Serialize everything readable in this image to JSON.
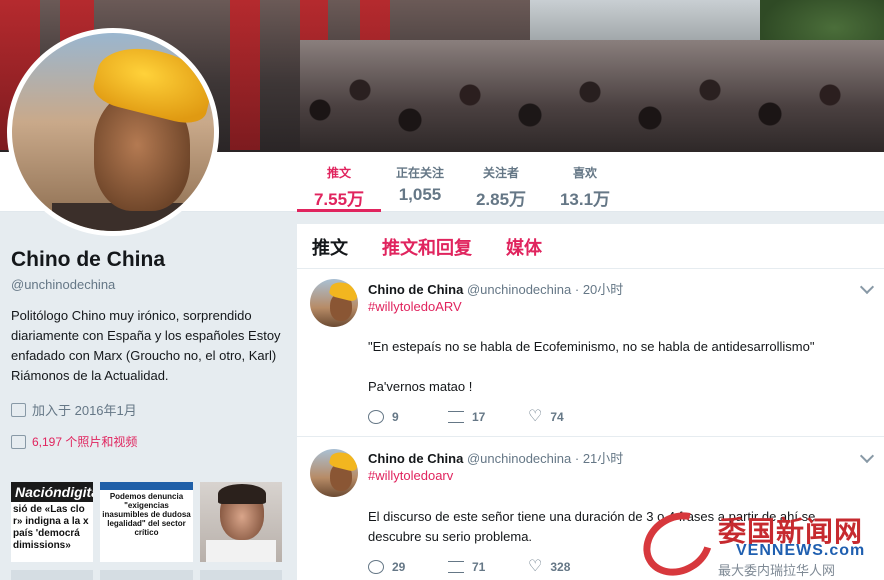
{
  "stats": [
    {
      "label": "推文",
      "value": "7.55万",
      "active": true
    },
    {
      "label": "正在关注",
      "value": "1,055",
      "active": false
    },
    {
      "label": "关注者",
      "value": "2.85万",
      "active": false
    },
    {
      "label": "喜欢",
      "value": "13.1万",
      "active": false
    }
  ],
  "profile": {
    "name": "Chino de China",
    "handle": "@unchinodechina",
    "bio": "Politólogo Chino muy irónico, sorprendido diariamente con España y los españoles Estoy enfadado con Marx (Groucho no, el otro, Karl) Riámonos de la Actualidad.",
    "joined": "加入于 2016年1月",
    "media_link": "6,197 个照片和视频",
    "calendar_icon": "calendar-icon",
    "photo_icon": "photo-icon"
  },
  "thumbnails": [
    {
      "header": "Nacióndigital",
      "text": "sió de «Las clo r» indigna a la x país 'democrá dimissions»"
    },
    {
      "text": "Podemos denuncia \"exigencias inasumibles de dudosa legalidad\" del sector crítico"
    },
    {
      "text": ""
    }
  ],
  "tabs": [
    "推文",
    "推文和回复",
    "媒体"
  ],
  "tweets": [
    {
      "name": "Chino de China",
      "handle": "@unchinodechina",
      "time": "· 20小时",
      "hashtag": "#willytoledoARV",
      "body": "\"En estepaís  no se habla de Ecofeminismo, no se habla de antidesarrollismo\"\n\nPa'vernos matao !",
      "replies": "9",
      "retweets": "17",
      "likes": "74"
    },
    {
      "name": "Chino de China",
      "handle": "@unchinodechina",
      "time": "· 21小时",
      "hashtag": "#willytoledoarv",
      "body": "El discurso de este señor tiene una duración de 3 o 4 frases a partir de ahí se descubre su serio problema.",
      "replies": "29",
      "retweets": "71",
      "likes": "328"
    }
  ],
  "watermark": {
    "title": "委国新闻网",
    "site": "VENNEWS.com",
    "slogan": "最大委内瑞拉华人网"
  },
  "colors": {
    "accent": "#e0245e",
    "muted": "#657786",
    "background": "#e6ecf0"
  }
}
